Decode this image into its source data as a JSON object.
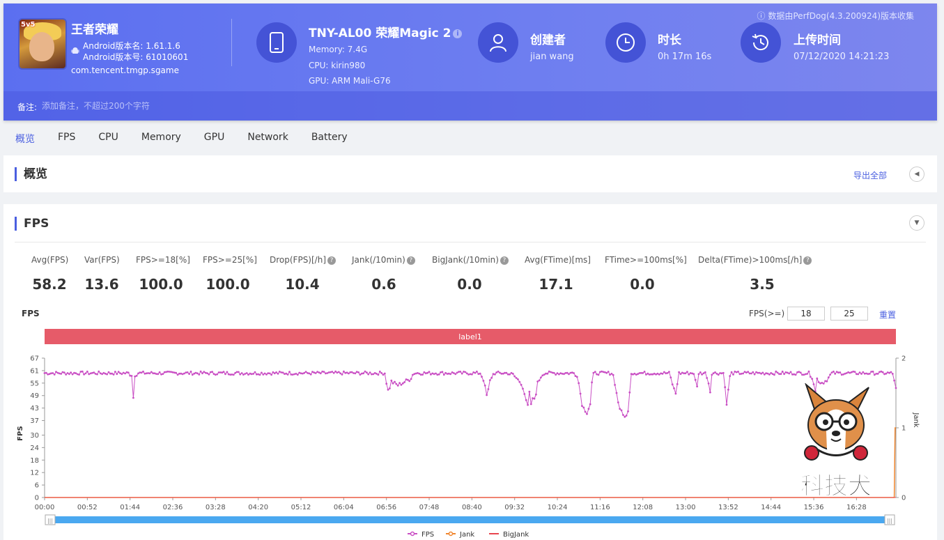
{
  "header": {
    "source_note": "数据由PerfDog(4.3.200924)版本收集",
    "app": {
      "name": "王者荣耀",
      "version_name": "Android版本名: 1.61.1.6",
      "version_code": "Android版本号: 61010601",
      "package": "com.tencent.tmgp.sgame",
      "icon_badge": "5v5"
    },
    "device": {
      "name": "TNY-AL00 荣耀Magic 2",
      "memory": "Memory: 7.4G",
      "cpu": "CPU: kirin980",
      "gpu": "GPU: ARM Mali-G76"
    },
    "creator": {
      "title": "创建者",
      "value": "jian wang"
    },
    "duration": {
      "title": "时长",
      "value": "0h 17m 16s"
    },
    "upload": {
      "title": "上传时间",
      "value": "07/12/2020 14:21:23"
    },
    "remark": {
      "label": "备注:",
      "placeholder": "添加备注，不超过200个字符"
    }
  },
  "tabs": [
    "概览",
    "FPS",
    "CPU",
    "Memory",
    "GPU",
    "Network",
    "Battery"
  ],
  "overview": {
    "title": "概览",
    "export_label": "导出全部"
  },
  "fps_panel": {
    "title": "FPS",
    "stats": [
      {
        "label": "Avg(FPS)",
        "value": "58.2",
        "help": false
      },
      {
        "label": "Var(FPS)",
        "value": "13.6",
        "help": false
      },
      {
        "label": "FPS>=18[%]",
        "value": "100.0",
        "help": false
      },
      {
        "label": "FPS>=25[%]",
        "value": "100.0",
        "help": false
      },
      {
        "label": "Drop(FPS)[/h]",
        "value": "10.4",
        "help": true
      },
      {
        "label": "Jank(/10min)",
        "value": "0.6",
        "help": true
      },
      {
        "label": "BigJank(/10min)",
        "value": "0.0",
        "help": true
      },
      {
        "label": "Avg(FTime)[ms]",
        "value": "17.1",
        "help": false
      },
      {
        "label": "FTime>=100ms[%]",
        "value": "0.0",
        "help": false
      },
      {
        "label": "Delta(FTime)>100ms[/h]",
        "value": "3.5",
        "help": true
      }
    ],
    "chart_title": "FPS",
    "threshold_label": "FPS(>=)",
    "threshold_1": "18",
    "threshold_2": "25",
    "reset_label": "重置",
    "watermark": "科技犬"
  },
  "chart_data": {
    "type": "line",
    "title": "FPS",
    "band_label": "label1",
    "ylabel": "FPS",
    "y2label": "Jank",
    "ylim": [
      0,
      67
    ],
    "y_ticks": [
      0,
      6,
      12,
      18,
      24,
      30,
      37,
      43,
      49,
      55,
      61,
      67
    ],
    "y2lim": [
      0,
      2
    ],
    "y2_ticks": [
      0,
      1,
      2
    ],
    "x_ticks": [
      "00:00",
      "00:52",
      "01:44",
      "02:36",
      "03:28",
      "04:20",
      "05:12",
      "06:04",
      "06:56",
      "07:48",
      "08:40",
      "09:32",
      "10:24",
      "11:16",
      "12:08",
      "13:00",
      "13:52",
      "14:44",
      "15:36",
      "16:28"
    ],
    "duration_seconds": 1036,
    "colors": {
      "fps": "#c94fc4",
      "jank": "#f0862e",
      "bigjank": "#e8454e",
      "band": "#e65b69",
      "slider": "#4aa8f0"
    },
    "legend": [
      "FPS",
      "Jank",
      "BigJank"
    ],
    "series": [
      {
        "name": "FPS",
        "points": [
          [
            0,
            60
          ],
          [
            60,
            60
          ],
          [
            100,
            60
          ],
          [
            106,
            59
          ],
          [
            108,
            48
          ],
          [
            110,
            59
          ],
          [
            115,
            60
          ],
          [
            200,
            60
          ],
          [
            300,
            60
          ],
          [
            400,
            60
          ],
          [
            414,
            60
          ],
          [
            417,
            53
          ],
          [
            419,
            50
          ],
          [
            421,
            56
          ],
          [
            425,
            55
          ],
          [
            430,
            54
          ],
          [
            435,
            55
          ],
          [
            440,
            56
          ],
          [
            445,
            57
          ],
          [
            448,
            59
          ],
          [
            450,
            60
          ],
          [
            520,
            60
          ],
          [
            530,
            60
          ],
          [
            535,
            56
          ],
          [
            537,
            50
          ],
          [
            539,
            48
          ],
          [
            541,
            55
          ],
          [
            545,
            59
          ],
          [
            550,
            60
          ],
          [
            560,
            60
          ],
          [
            570,
            59
          ],
          [
            575,
            57
          ],
          [
            580,
            55
          ],
          [
            583,
            52
          ],
          [
            586,
            46
          ],
          [
            588,
            44
          ],
          [
            590,
            50
          ],
          [
            592,
            45
          ],
          [
            594,
            47
          ],
          [
            597,
            48
          ],
          [
            600,
            55
          ],
          [
            605,
            59
          ],
          [
            610,
            60
          ],
          [
            640,
            60
          ],
          [
            648,
            59
          ],
          [
            650,
            55
          ],
          [
            652,
            50
          ],
          [
            654,
            45
          ],
          [
            656,
            43
          ],
          [
            658,
            42
          ],
          [
            660,
            41
          ],
          [
            662,
            43
          ],
          [
            664,
            45
          ],
          [
            666,
            55
          ],
          [
            668,
            59
          ],
          [
            670,
            60
          ],
          [
            690,
            60
          ],
          [
            693,
            58
          ],
          [
            695,
            52
          ],
          [
            697,
            48
          ],
          [
            699,
            44
          ],
          [
            701,
            42
          ],
          [
            703,
            40
          ],
          [
            705,
            39
          ],
          [
            707,
            40
          ],
          [
            709,
            38
          ],
          [
            711,
            44
          ],
          [
            713,
            59
          ],
          [
            715,
            60
          ],
          [
            760,
            60
          ],
          [
            763,
            56
          ],
          [
            766,
            52
          ],
          [
            768,
            50
          ],
          [
            770,
            55
          ],
          [
            772,
            60
          ],
          [
            790,
            60
          ],
          [
            792,
            56
          ],
          [
            794,
            53
          ],
          [
            796,
            60
          ],
          [
            805,
            60
          ],
          [
            808,
            55
          ],
          [
            810,
            51
          ],
          [
            812,
            60
          ],
          [
            826,
            60
          ],
          [
            828,
            54
          ],
          [
            830,
            44
          ],
          [
            832,
            52
          ],
          [
            834,
            58
          ],
          [
            836,
            60
          ],
          [
            900,
            60
          ],
          [
            930,
            60
          ],
          [
            934,
            58
          ],
          [
            936,
            55
          ],
          [
            938,
            51
          ],
          [
            940,
            57
          ],
          [
            945,
            55
          ],
          [
            950,
            56
          ],
          [
            955,
            58
          ],
          [
            958,
            60
          ],
          [
            1030,
            60
          ],
          [
            1033,
            59
          ],
          [
            1036,
            52
          ]
        ]
      },
      {
        "name": "Jank",
        "values_note": "flat at 0 with a single spike to 1 near end",
        "points": [
          [
            0,
            0
          ],
          [
            1034,
            0
          ],
          [
            1035,
            1
          ],
          [
            1036,
            1
          ]
        ]
      },
      {
        "name": "BigJank",
        "points": [
          [
            0,
            0
          ],
          [
            1036,
            0
          ]
        ]
      }
    ]
  }
}
